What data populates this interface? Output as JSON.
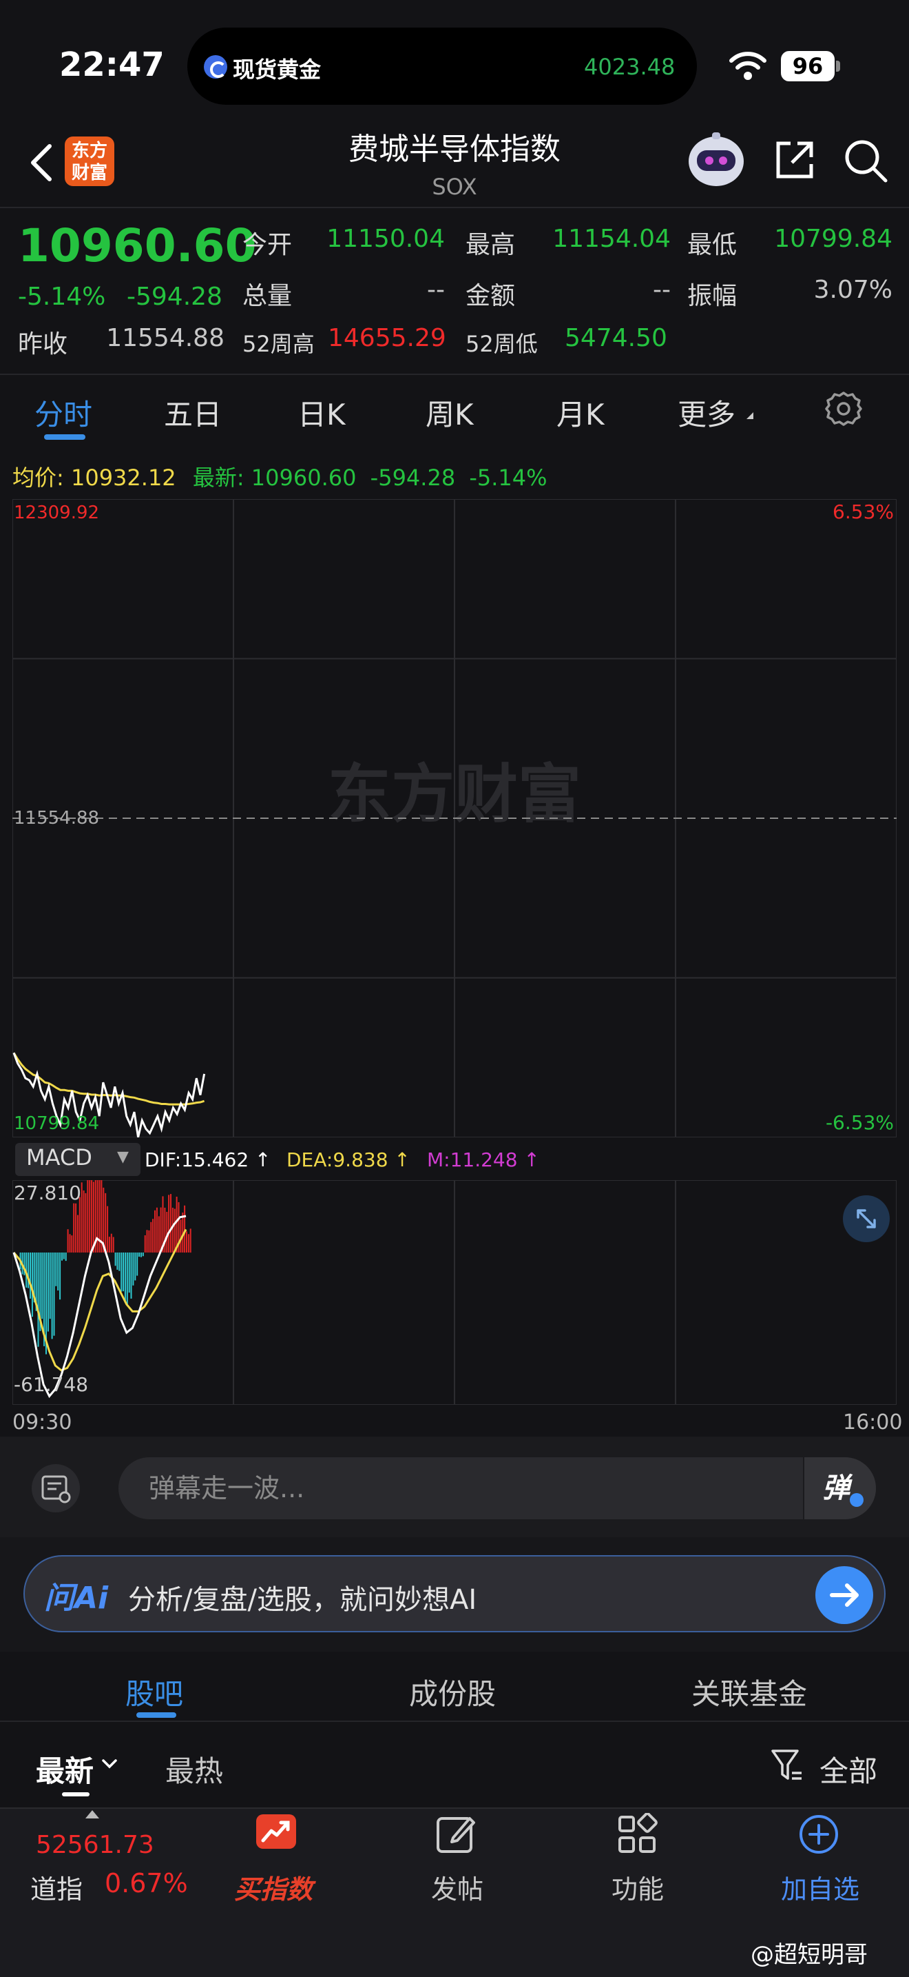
{
  "status_bar": {
    "time": "22:47",
    "island_label": "现货黄金",
    "island_price": "4023.48",
    "battery": "96"
  },
  "header": {
    "logo_text_line1": "东方",
    "logo_text_line2": "财富",
    "title": "费城半导体指数",
    "subtitle": "SOX"
  },
  "quote": {
    "last_price": "10960.60",
    "change_pct": "-5.14%",
    "change_amt": "-594.28",
    "prev_close_label": "昨收",
    "prev_close": "11554.88",
    "open_label": "今开",
    "open": "11150.04",
    "high_label": "最高",
    "high": "11154.04",
    "low_label": "最低",
    "low": "10799.84",
    "volume_label": "总量",
    "volume": "--",
    "amount_label": "金额",
    "amount": "--",
    "amplitude_label": "振幅",
    "amplitude": "3.07%",
    "w52_high_label": "52周高",
    "w52_high": "14655.29",
    "w52_low_label": "52周低",
    "w52_low": "5474.50"
  },
  "tabs": [
    {
      "label": "分时"
    },
    {
      "label": "五日"
    },
    {
      "label": "日K"
    },
    {
      "label": "周K"
    },
    {
      "label": "月K"
    },
    {
      "label": "更多"
    }
  ],
  "avg_bar": {
    "avg_label": "均价:",
    "avg_value": "10932.12",
    "latest_label": "最新:",
    "latest_value": "10960.60",
    "latest_chg": "-594.28",
    "latest_pct": "-5.14%"
  },
  "chart_data": {
    "type": "line",
    "title": "",
    "y_top_label": "12309.92",
    "y_mid_label": "11554.88",
    "y_bottom_label": "10799.84",
    "pct_top_label": "6.53%",
    "pct_bottom_label": "-6.53%",
    "watermark": "东方财富",
    "ylim": [
      10799.84,
      12309.92
    ],
    "reference_line": 11554.88,
    "x_start_label": "09:30",
    "x_end_label": "16:00",
    "series": [
      {
        "values": [
          11000,
          10975,
          10960,
          10940,
          10935,
          10920,
          10950,
          10910,
          10890,
          10920,
          10880,
          10850,
          10830,
          10890,
          10870,
          10910,
          10860,
          10840,
          10880,
          10900,
          10870,
          10895,
          10850,
          10930,
          10900,
          10870,
          10920,
          10880,
          10905,
          10850,
          10830,
          10860,
          10800,
          10840,
          10820,
          10810,
          10830,
          10850,
          10820,
          10860,
          10840,
          10870,
          10855,
          10880,
          10865,
          10905,
          10890,
          10940,
          10900,
          10950
        ]
      },
      {
        "values": [
          11000,
          10985,
          10972,
          10962,
          10955,
          10948,
          10945,
          10938,
          10930,
          10928,
          10923,
          10917,
          10912,
          10912,
          10910,
          10910,
          10907,
          10904,
          10903,
          10903,
          10901,
          10901,
          10899,
          10900,
          10900,
          10899,
          10900,
          10899,
          10899,
          10897,
          10895,
          10894,
          10891,
          10889,
          10887,
          10884,
          10882,
          10881,
          10879,
          10879,
          10878,
          10878,
          10878,
          10878,
          10878,
          10879,
          10880,
          10882,
          10883,
          10886
        ]
      }
    ],
    "macd": {
      "indicator": "MACD",
      "dif_label": "DIF:15.462 ↑",
      "dea_label": "DEA:9.838 ↑",
      "m_label": "M:11.248 ↑",
      "y_top_label": "27.810",
      "y_bottom_label": "-61.748",
      "ylim": [
        -61.748,
        27.81
      ],
      "dif": [
        0,
        -8,
        -18,
        -30,
        -44,
        -56,
        -61,
        -58,
        -52,
        -44,
        -34,
        -22,
        -10,
        0,
        6,
        4,
        -4,
        -16,
        -28,
        -34,
        -32,
        -26,
        -18,
        -10,
        -4,
        2,
        8,
        12,
        15,
        15.5
      ],
      "dea": [
        0,
        -3,
        -8,
        -15,
        -24,
        -34,
        -42,
        -48,
        -50,
        -49,
        -45,
        -39,
        -32,
        -24,
        -16,
        -10,
        -9,
        -12,
        -17,
        -22,
        -25,
        -25,
        -23,
        -19,
        -15,
        -10,
        -5,
        0,
        5,
        9.8
      ],
      "hist": [
        0,
        -10,
        -20,
        -30,
        -40,
        -44,
        -38,
        -20,
        -4,
        10,
        22,
        30,
        36,
        42,
        44,
        28,
        8,
        -8,
        -22,
        -24,
        -14,
        -2,
        10,
        18,
        22,
        24,
        26,
        24,
        20,
        11
      ]
    }
  },
  "macd_controls": {
    "caret": "▼"
  },
  "danmaku": {
    "placeholder": "弹幕走一波...",
    "send_label": "弹"
  },
  "ai": {
    "logo": "问Ai",
    "prompt": "分析/复盘/选股，就问妙想AI"
  },
  "community_tabs": [
    {
      "label": "股吧"
    },
    {
      "label": "成份股"
    },
    {
      "label": "关联基金"
    }
  ],
  "sort": {
    "latest": "最新",
    "hot": "最热",
    "filter": "全部"
  },
  "bottom_nav": {
    "dow_price": "52561.73",
    "dow_name": "道指",
    "dow_pct": "0.67%",
    "items": [
      {
        "label": "买指数"
      },
      {
        "label": "发帖"
      },
      {
        "label": "功能"
      },
      {
        "label": "加自选"
      }
    ]
  },
  "watermark": "@超短明哥",
  "colors": {
    "up": "#f02a2a",
    "down": "#25c340",
    "accent": "#3a8ee6",
    "price_line": "#ffffff",
    "avg_line": "#f0d94a",
    "macd_m": "#d23cd2"
  }
}
